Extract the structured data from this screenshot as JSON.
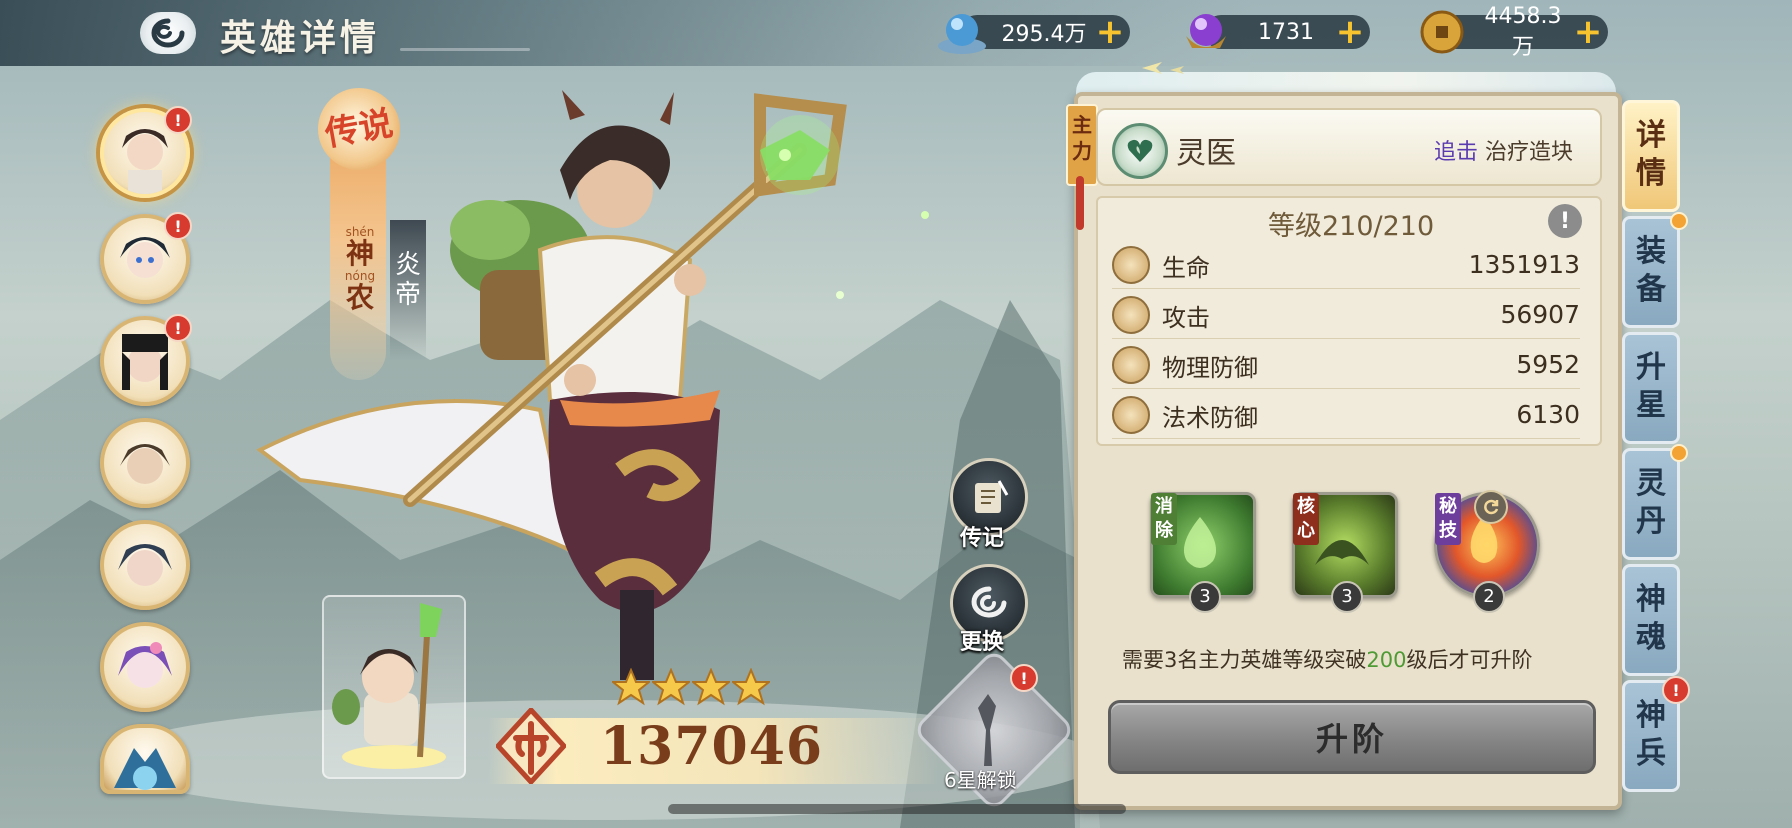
{
  "header": {
    "title": "英雄详情",
    "currencies": [
      {
        "name": "jade",
        "value": "295.4万",
        "icon": "blue-orb-icon"
      },
      {
        "name": "spirit",
        "value": "1731",
        "icon": "purple-orb-icon"
      },
      {
        "name": "coin",
        "value": "4458.3万",
        "icon": "gold-coin-icon"
      }
    ],
    "plus": "+"
  },
  "roster": {
    "alerts": [
      "!",
      "!",
      "!"
    ]
  },
  "hero": {
    "rarity": "传说",
    "name_pinyin": [
      "shén",
      "nóng"
    ],
    "name_chars": [
      "神",
      "农"
    ],
    "title_chars": [
      "炎",
      "帝"
    ],
    "stars": 4,
    "power": "137046"
  },
  "actions": {
    "biography": "传记",
    "change": "更换",
    "unlock": "6星解锁",
    "alert": "!"
  },
  "panel": {
    "main_tag": "主力",
    "class_name": "灵医",
    "class_tags": {
      "highlight": "追击",
      "rest": "治疗造块"
    },
    "level": "等级210/210",
    "info": "!",
    "stats": [
      {
        "label": "生命",
        "value": "1351913",
        "icon": "heart-icon"
      },
      {
        "label": "攻击",
        "value": "56907",
        "icon": "sword-icon"
      },
      {
        "label": "物理防御",
        "value": "5952",
        "icon": "shield-icon"
      },
      {
        "label": "法术防御",
        "value": "6130",
        "icon": "magic-shield-icon"
      }
    ],
    "skills": [
      {
        "tag": "消除",
        "level": "3",
        "color": "#4f7e35"
      },
      {
        "tag": "核心",
        "level": "3",
        "color": "#8e2f1e"
      },
      {
        "tag": "秘技",
        "level": "2",
        "color": "#6e3e9c"
      }
    ],
    "requirement": {
      "prefix": "需要3名主力英雄等级突破",
      "number": "200",
      "suffix": "级后才可升阶"
    },
    "upgrade_label": "升阶"
  },
  "tabs": [
    {
      "label": "详情",
      "active": true
    },
    {
      "label": "装备"
    },
    {
      "label": "升星"
    },
    {
      "label": "灵丹"
    },
    {
      "label": "神魂"
    },
    {
      "label": "神兵"
    }
  ],
  "colors": {
    "accent": "#f0c778",
    "tab": "#89a9c0",
    "panel": "#e9e1cc",
    "alert": "#d73a2e"
  }
}
